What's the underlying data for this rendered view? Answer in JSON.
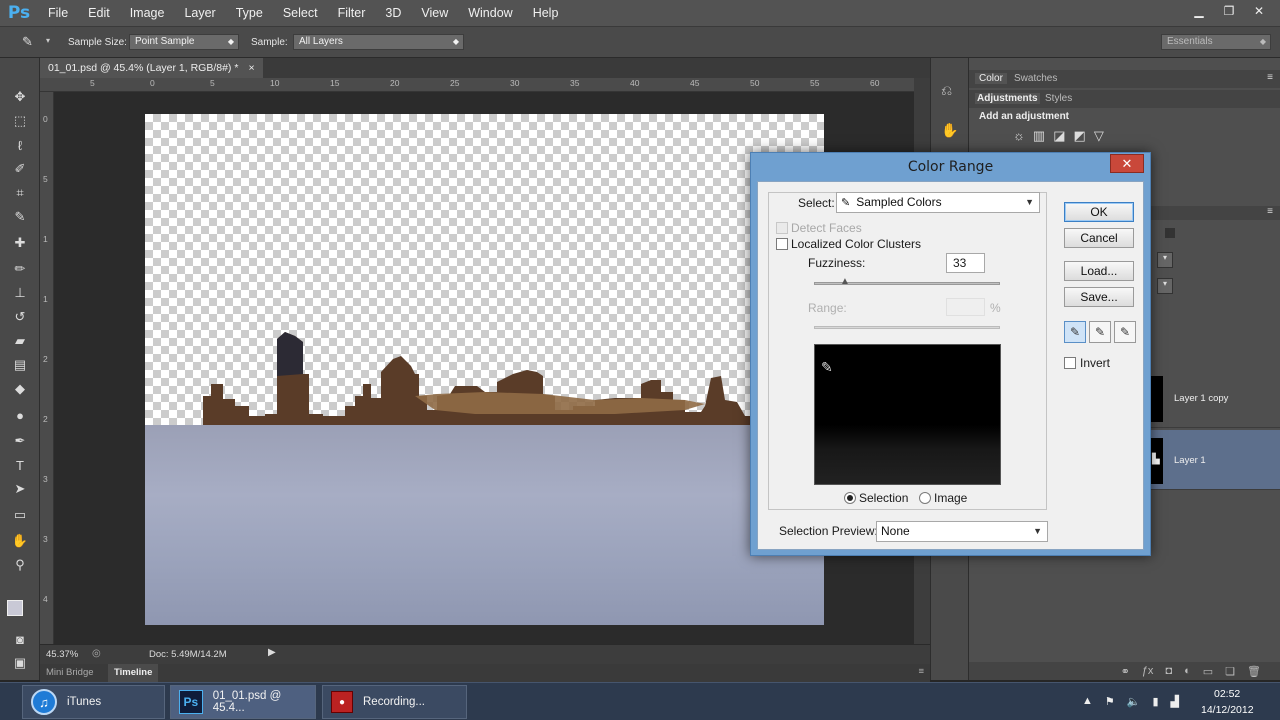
{
  "menubar": {
    "logo": "Ps",
    "items": [
      "File",
      "Edit",
      "Image",
      "Layer",
      "Type",
      "Select",
      "Filter",
      "3D",
      "View",
      "Window",
      "Help"
    ]
  },
  "options": {
    "sample_size_label": "Sample Size:",
    "sample_size_value": "Point Sample",
    "sample_label": "Sample:",
    "sample_value": "All Layers",
    "workspace": "Essentials"
  },
  "document": {
    "tab_title": "01_01.psd @ 45.4% (Layer 1, RGB/8#) *",
    "tab_close": "×",
    "ruler_top": [
      "5",
      "0",
      "5",
      "10",
      "15",
      "20",
      "25",
      "30",
      "35",
      "40",
      "45",
      "50",
      "55",
      "60"
    ],
    "ruler_left": [
      "0",
      "5",
      "1",
      "1",
      "2",
      "2",
      "3",
      "3",
      "4",
      "5"
    ],
    "zoom": "45.37%",
    "doc_size": "Doc: 5.49M/14.2M",
    "bottom_tabs": [
      "Mini Bridge",
      "Timeline"
    ]
  },
  "panels": {
    "tabs_top": [
      "Color",
      "Swatches"
    ],
    "tabs_adj": [
      "Adjustments",
      "Styles"
    ],
    "add_adjustment": "Add an adjustment",
    "layers": [
      {
        "name": "Layer 1 copy",
        "selected": false
      },
      {
        "name": "Layer 1",
        "selected": true
      }
    ]
  },
  "dialog": {
    "title": "Color Range",
    "close": "✕",
    "select_label": "Select:",
    "select_value": "Sampled Colors",
    "detect_faces": "Detect Faces",
    "localized": "Localized Color Clusters",
    "fuzziness_label": "Fuzziness:",
    "fuzziness_value": "33",
    "range_label": "Range:",
    "range_unit": "%",
    "selection_radio": "Selection",
    "image_radio": "Image",
    "preview_label": "Selection Preview:",
    "preview_value": "None",
    "buttons": {
      "ok": "OK",
      "cancel": "Cancel",
      "load": "Load...",
      "save": "Save..."
    },
    "invert": "Invert"
  },
  "taskbar": {
    "items": [
      "iTunes",
      "01_01.psd @ 45.4...",
      "Recording..."
    ],
    "time": "02:52",
    "date": "14/12/2012"
  }
}
